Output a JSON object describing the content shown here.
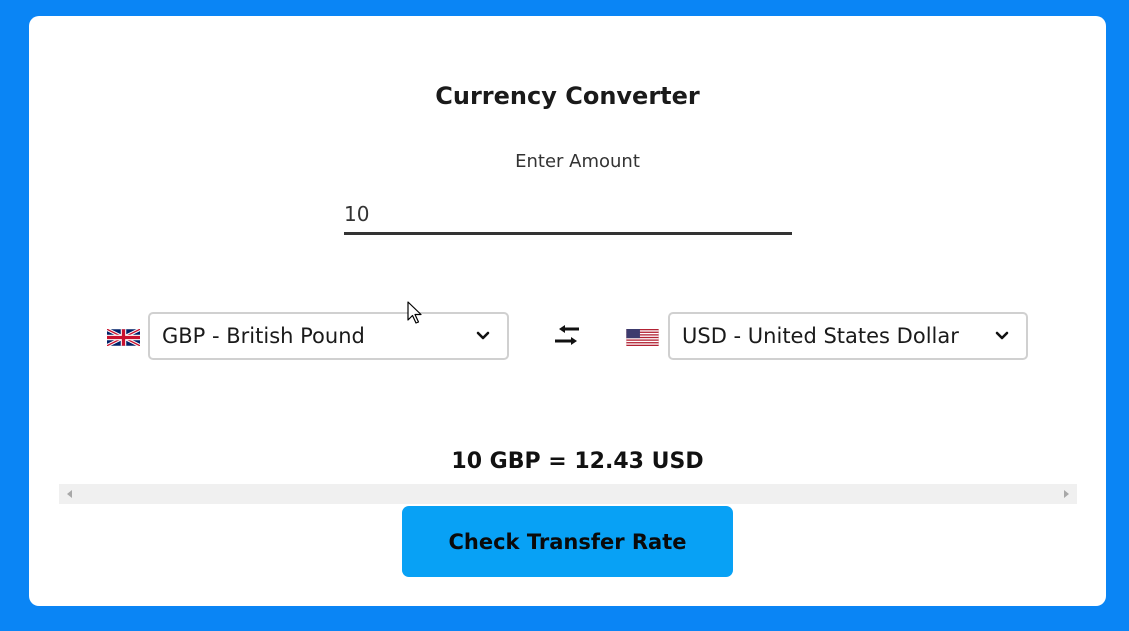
{
  "app": {
    "title": "Currency Converter"
  },
  "amount": {
    "label": "Enter Amount",
    "value": "10"
  },
  "from_currency": {
    "selected": "GBP - British Pound",
    "flag": "uk-flag-icon"
  },
  "to_currency": {
    "selected": "USD - United States Dollar",
    "flag": "us-flag-icon"
  },
  "result": {
    "text": "10 GBP = 12.43 USD"
  },
  "actions": {
    "check_label": "Check Transfer Rate"
  },
  "colors": {
    "background": "#0a85f5",
    "card": "#ffffff",
    "button": "#08a1f5"
  }
}
